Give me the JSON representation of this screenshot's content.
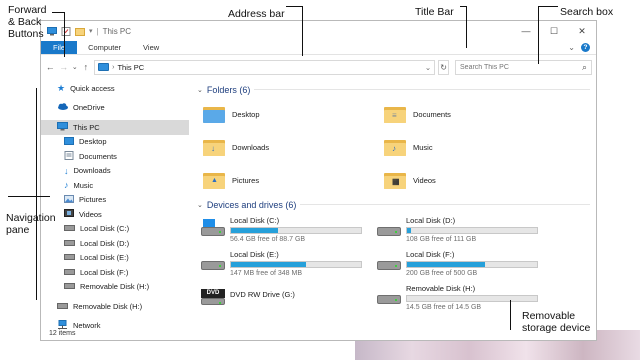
{
  "annotations": {
    "forward_back": "Forward & Back Buttons",
    "address_bar": "Address bar",
    "title_bar": "Title Bar",
    "search_box": "Search box",
    "navigation_pane": "Navigation pane",
    "removable_storage": "Removable storage device"
  },
  "window": {
    "title": "This PC",
    "controls": {
      "minimize": "—",
      "maximize": "☐",
      "close": "✕"
    }
  },
  "ribbon": {
    "tabs": [
      "File",
      "Computer",
      "View"
    ],
    "expand": "⌄",
    "help": "?"
  },
  "navbar": {
    "back": "←",
    "forward": "→",
    "recent": "⌄",
    "up": "↑",
    "path": "This PC",
    "path_sep": "›",
    "refresh": "↻",
    "search_placeholder": "Search This PC",
    "search_icon": "⌕"
  },
  "navpane": {
    "items": [
      {
        "label": "Quick access",
        "icon": "star-icon"
      },
      {
        "label": "OneDrive",
        "icon": "cloud-icon"
      },
      {
        "label": "This PC",
        "icon": "computer-icon",
        "selected": true
      },
      {
        "label": "Desktop",
        "icon": "desktop-folder-icon"
      },
      {
        "label": "Documents",
        "icon": "documents-folder-icon"
      },
      {
        "label": "Downloads",
        "icon": "downloads-folder-icon"
      },
      {
        "label": "Music",
        "icon": "music-folder-icon"
      },
      {
        "label": "Pictures",
        "icon": "pictures-folder-icon"
      },
      {
        "label": "Videos",
        "icon": "videos-folder-icon"
      },
      {
        "label": "Local Disk (C:)",
        "icon": "drive-icon"
      },
      {
        "label": "Local Disk (D:)",
        "icon": "drive-icon"
      },
      {
        "label": "Local Disk (E:)",
        "icon": "drive-icon"
      },
      {
        "label": "Local Disk (F:)",
        "icon": "drive-icon"
      },
      {
        "label": "Removable Disk (H:)",
        "icon": "drive-icon"
      },
      {
        "label": "Removable Disk (H:)",
        "icon": "drive-icon"
      },
      {
        "label": "Network",
        "icon": "network-icon"
      }
    ]
  },
  "folders": {
    "header": "Folders (6)",
    "items": [
      {
        "label": "Desktop",
        "glyph": ""
      },
      {
        "label": "Documents",
        "glyph": "≡"
      },
      {
        "label": "Downloads",
        "glyph": "↓"
      },
      {
        "label": "Music",
        "glyph": "♪"
      },
      {
        "label": "Pictures",
        "glyph": "▲"
      },
      {
        "label": "Videos",
        "glyph": "▦"
      }
    ]
  },
  "drives": {
    "header": "Devices and drives (6)",
    "items": [
      {
        "name": "Local Disk (C:)",
        "free": "56.4 GB free of 88.7 GB",
        "used_fraction": 0.36,
        "kind": "system"
      },
      {
        "name": "Local Disk (D:)",
        "free": "108 GB free of 111 GB",
        "used_fraction": 0.03,
        "kind": "hdd"
      },
      {
        "name": "Local Disk (E:)",
        "free": "147 MB free of 348 MB",
        "used_fraction": 0.58,
        "kind": "hdd"
      },
      {
        "name": "Local Disk (F:)",
        "free": "200 GB free of 500 GB",
        "used_fraction": 0.6,
        "kind": "hdd"
      },
      {
        "name": "DVD RW Drive (G:)",
        "free": "",
        "used_fraction": null,
        "kind": "dvd",
        "dvd_label": "DVD"
      },
      {
        "name": "Removable Disk (H:)",
        "free": "14.5 GB free of 14.5 GB",
        "used_fraction": 0.0,
        "kind": "hdd"
      }
    ]
  },
  "status": {
    "count": "12 items"
  },
  "colors": {
    "accent": "#1979ca",
    "bar_fill": "#26a0da",
    "header_text": "#1e3e7e"
  }
}
